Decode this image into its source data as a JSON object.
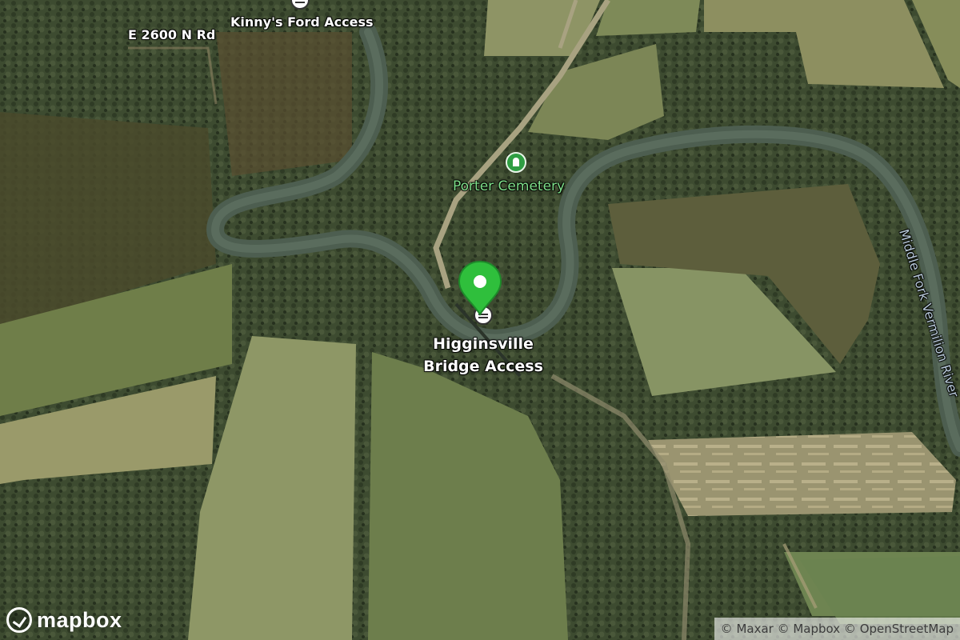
{
  "labels": {
    "road": "E 2600 N Rd",
    "kinny": "Kinny's Ford Access",
    "cemetery": "Porter Cemetery",
    "higginsville_line1": "Higginsville",
    "higginsville_line2": "Bridge Access",
    "river": "Middle Fork Vermilion River"
  },
  "icons": {
    "access": "boat-launch-icon",
    "cemetery": "cemetery-icon",
    "marker": "location-pin-icon"
  },
  "colors": {
    "marker": "#2fbf3c",
    "cemetery_label": "#7fe08a",
    "label": "#ffffff"
  },
  "logo": {
    "text": "mapbox"
  },
  "attribution": {
    "items": [
      "© Maxar",
      "© Mapbox",
      "© OpenStreetMap"
    ]
  }
}
